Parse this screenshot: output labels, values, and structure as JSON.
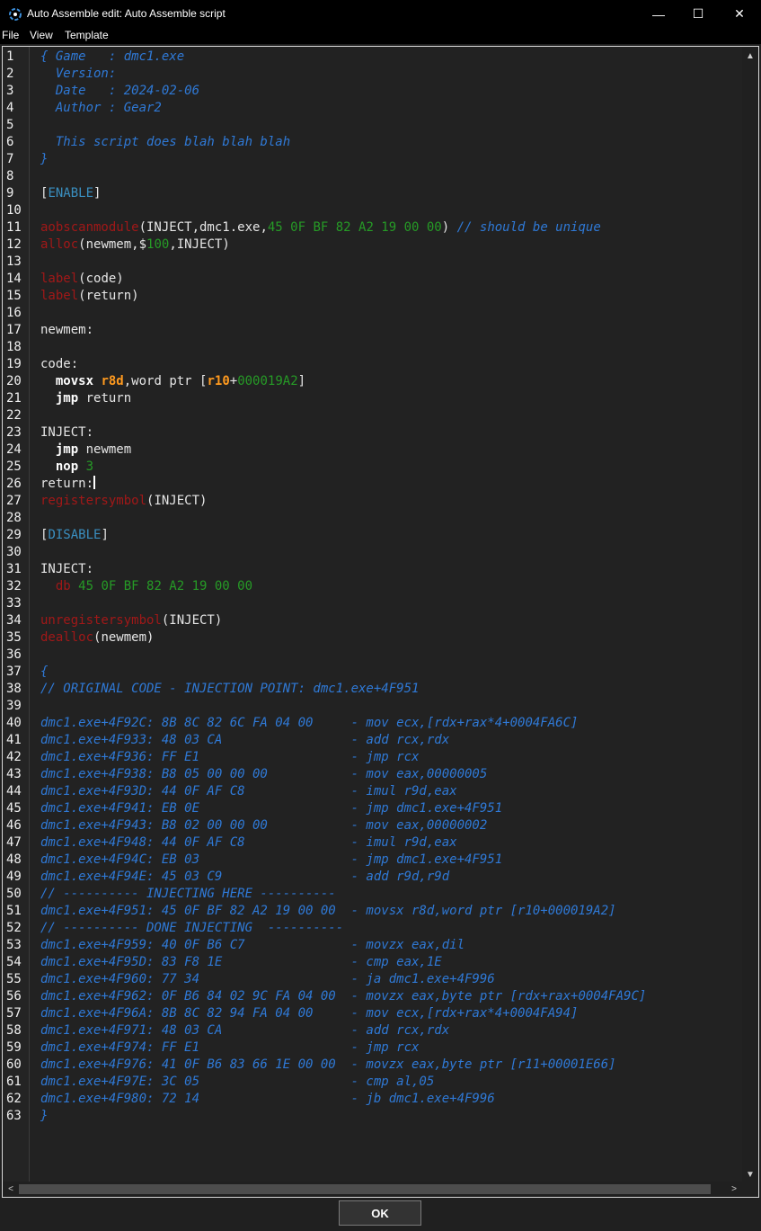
{
  "window": {
    "title": "Auto Assemble edit: Auto Assemble script",
    "minimize_glyph": "—",
    "maximize_glyph": "☐",
    "close_glyph": "✕"
  },
  "menu": {
    "items": [
      "File",
      "View",
      "Template"
    ]
  },
  "colors": {
    "comment": "#2f79d6",
    "section": "#3a8fc0",
    "aa_command": "#a11818",
    "hex_value": "#269b26",
    "instruction": "#ffffff",
    "register": "#ff9a1f",
    "plain": "#e6e6e6",
    "background": "#222222"
  },
  "editor": {
    "cursor_line": 26,
    "lines": [
      [
        [
          "c",
          "{ Game   : dmc1.exe"
        ]
      ],
      [
        [
          "c",
          "  Version: "
        ]
      ],
      [
        [
          "c",
          "  Date   : 2024-02-06"
        ]
      ],
      [
        [
          "c",
          "  Author : Gear2"
        ]
      ],
      [],
      [
        [
          "c",
          "  This script does blah blah blah"
        ]
      ],
      [
        [
          "c",
          "}"
        ]
      ],
      [],
      [
        [
          "b",
          "["
        ],
        [
          "s",
          "ENABLE"
        ],
        [
          "b",
          "]"
        ]
      ],
      [],
      [
        [
          "a",
          "aobscanmodule"
        ],
        [
          "p",
          "(INJECT,dmc1.exe,"
        ],
        [
          "h",
          "45 0F BF 82 A2 19 00 00"
        ],
        [
          "p",
          ") "
        ],
        [
          "c",
          "// should be unique"
        ]
      ],
      [
        [
          "a",
          "alloc"
        ],
        [
          "p",
          "(newmem,$"
        ],
        [
          "h",
          "100"
        ],
        [
          "p",
          ",INJECT)"
        ]
      ],
      [],
      [
        [
          "a",
          "label"
        ],
        [
          "p",
          "(code)"
        ]
      ],
      [
        [
          "a",
          "label"
        ],
        [
          "p",
          "(return)"
        ]
      ],
      [],
      [
        [
          "p",
          "newmem:"
        ]
      ],
      [],
      [
        [
          "p",
          "code:"
        ]
      ],
      [
        [
          "p",
          "  "
        ],
        [
          "i",
          "movsx"
        ],
        [
          "p",
          " "
        ],
        [
          "r",
          "r8d"
        ],
        [
          "p",
          ",word ptr ["
        ],
        [
          "r",
          "r10"
        ],
        [
          "p",
          "+"
        ],
        [
          "h",
          "000019A2"
        ],
        [
          "p",
          "]"
        ]
      ],
      [
        [
          "p",
          "  "
        ],
        [
          "i",
          "jmp"
        ],
        [
          "p",
          " return"
        ]
      ],
      [],
      [
        [
          "p",
          "INJECT:"
        ]
      ],
      [
        [
          "p",
          "  "
        ],
        [
          "i",
          "jmp"
        ],
        [
          "p",
          " newmem"
        ]
      ],
      [
        [
          "p",
          "  "
        ],
        [
          "i",
          "nop"
        ],
        [
          "p",
          " "
        ],
        [
          "h",
          "3"
        ]
      ],
      [
        [
          "p",
          "return:"
        ]
      ],
      [
        [
          "a",
          "registersymbol"
        ],
        [
          "p",
          "(INJECT)"
        ]
      ],
      [],
      [
        [
          "b",
          "["
        ],
        [
          "s",
          "DISABLE"
        ],
        [
          "b",
          "]"
        ]
      ],
      [],
      [
        [
          "p",
          "INJECT:"
        ]
      ],
      [
        [
          "p",
          "  "
        ],
        [
          "a",
          "db"
        ],
        [
          "p",
          " "
        ],
        [
          "h",
          "45 0F BF 82 A2 19 00 00"
        ]
      ],
      [],
      [
        [
          "a",
          "unregistersymbol"
        ],
        [
          "p",
          "(INJECT)"
        ]
      ],
      [
        [
          "a",
          "dealloc"
        ],
        [
          "p",
          "(newmem)"
        ]
      ],
      [],
      [
        [
          "c",
          "{"
        ]
      ],
      [
        [
          "c",
          "// ORIGINAL CODE - INJECTION POINT: dmc1.exe+4F951"
        ]
      ],
      [],
      [
        [
          "c",
          "dmc1.exe+4F92C: 8B 8C 82 6C FA 04 00     - mov ecx,[rdx+rax*4+0004FA6C]"
        ]
      ],
      [
        [
          "c",
          "dmc1.exe+4F933: 48 03 CA                 - add rcx,rdx"
        ]
      ],
      [
        [
          "c",
          "dmc1.exe+4F936: FF E1                    - jmp rcx"
        ]
      ],
      [
        [
          "c",
          "dmc1.exe+4F938: B8 05 00 00 00           - mov eax,00000005"
        ]
      ],
      [
        [
          "c",
          "dmc1.exe+4F93D: 44 0F AF C8              - imul r9d,eax"
        ]
      ],
      [
        [
          "c",
          "dmc1.exe+4F941: EB 0E                    - jmp dmc1.exe+4F951"
        ]
      ],
      [
        [
          "c",
          "dmc1.exe+4F943: B8 02 00 00 00           - mov eax,00000002"
        ]
      ],
      [
        [
          "c",
          "dmc1.exe+4F948: 44 0F AF C8              - imul r9d,eax"
        ]
      ],
      [
        [
          "c",
          "dmc1.exe+4F94C: EB 03                    - jmp dmc1.exe+4F951"
        ]
      ],
      [
        [
          "c",
          "dmc1.exe+4F94E: 45 03 C9                 - add r9d,r9d"
        ]
      ],
      [
        [
          "c",
          "// ---------- INJECTING HERE ----------"
        ]
      ],
      [
        [
          "c",
          "dmc1.exe+4F951: 45 0F BF 82 A2 19 00 00  - movsx r8d,word ptr [r10+000019A2]"
        ]
      ],
      [
        [
          "c",
          "// ---------- DONE INJECTING  ----------"
        ]
      ],
      [
        [
          "c",
          "dmc1.exe+4F959: 40 0F B6 C7              - movzx eax,dil"
        ]
      ],
      [
        [
          "c",
          "dmc1.exe+4F95D: 83 F8 1E                 - cmp eax,1E"
        ]
      ],
      [
        [
          "c",
          "dmc1.exe+4F960: 77 34                    - ja dmc1.exe+4F996"
        ]
      ],
      [
        [
          "c",
          "dmc1.exe+4F962: 0F B6 84 02 9C FA 04 00  - movzx eax,byte ptr [rdx+rax+0004FA9C]"
        ]
      ],
      [
        [
          "c",
          "dmc1.exe+4F96A: 8B 8C 82 94 FA 04 00     - mov ecx,[rdx+rax*4+0004FA94]"
        ]
      ],
      [
        [
          "c",
          "dmc1.exe+4F971: 48 03 CA                 - add rcx,rdx"
        ]
      ],
      [
        [
          "c",
          "dmc1.exe+4F974: FF E1                    - jmp rcx"
        ]
      ],
      [
        [
          "c",
          "dmc1.exe+4F976: 41 0F B6 83 66 1E 00 00  - movzx eax,byte ptr [r11+00001E66]"
        ]
      ],
      [
        [
          "c",
          "dmc1.exe+4F97E: 3C 05                    - cmp al,05"
        ]
      ],
      [
        [
          "c",
          "dmc1.exe+4F980: 72 14                    - jb dmc1.exe+4F996"
        ]
      ],
      [
        [
          "c",
          "}"
        ]
      ]
    ]
  },
  "footer": {
    "ok_label": "OK"
  },
  "icons": {
    "app": "cheat-engine-icon",
    "scroll_up": "▲",
    "scroll_down": "▼",
    "scroll_left": "<",
    "scroll_right": ">"
  }
}
